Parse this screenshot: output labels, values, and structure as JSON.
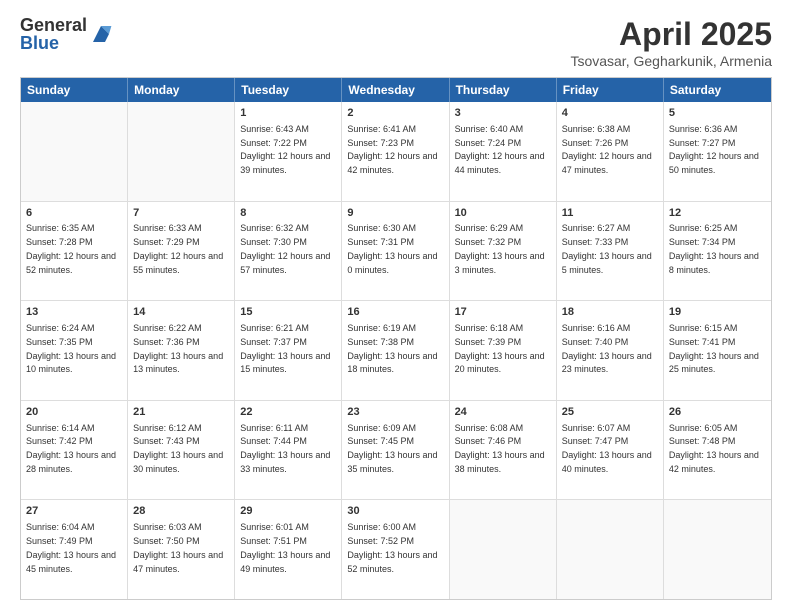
{
  "logo": {
    "general": "General",
    "blue": "Blue"
  },
  "title": "April 2025",
  "location": "Tsovasar, Gegharkunik, Armenia",
  "days": [
    "Sunday",
    "Monday",
    "Tuesday",
    "Wednesday",
    "Thursday",
    "Friday",
    "Saturday"
  ],
  "weeks": [
    [
      {
        "day": "",
        "text": ""
      },
      {
        "day": "",
        "text": ""
      },
      {
        "day": "1",
        "text": "Sunrise: 6:43 AM\nSunset: 7:22 PM\nDaylight: 12 hours and 39 minutes."
      },
      {
        "day": "2",
        "text": "Sunrise: 6:41 AM\nSunset: 7:23 PM\nDaylight: 12 hours and 42 minutes."
      },
      {
        "day": "3",
        "text": "Sunrise: 6:40 AM\nSunset: 7:24 PM\nDaylight: 12 hours and 44 minutes."
      },
      {
        "day": "4",
        "text": "Sunrise: 6:38 AM\nSunset: 7:26 PM\nDaylight: 12 hours and 47 minutes."
      },
      {
        "day": "5",
        "text": "Sunrise: 6:36 AM\nSunset: 7:27 PM\nDaylight: 12 hours and 50 minutes."
      }
    ],
    [
      {
        "day": "6",
        "text": "Sunrise: 6:35 AM\nSunset: 7:28 PM\nDaylight: 12 hours and 52 minutes."
      },
      {
        "day": "7",
        "text": "Sunrise: 6:33 AM\nSunset: 7:29 PM\nDaylight: 12 hours and 55 minutes."
      },
      {
        "day": "8",
        "text": "Sunrise: 6:32 AM\nSunset: 7:30 PM\nDaylight: 12 hours and 57 minutes."
      },
      {
        "day": "9",
        "text": "Sunrise: 6:30 AM\nSunset: 7:31 PM\nDaylight: 13 hours and 0 minutes."
      },
      {
        "day": "10",
        "text": "Sunrise: 6:29 AM\nSunset: 7:32 PM\nDaylight: 13 hours and 3 minutes."
      },
      {
        "day": "11",
        "text": "Sunrise: 6:27 AM\nSunset: 7:33 PM\nDaylight: 13 hours and 5 minutes."
      },
      {
        "day": "12",
        "text": "Sunrise: 6:25 AM\nSunset: 7:34 PM\nDaylight: 13 hours and 8 minutes."
      }
    ],
    [
      {
        "day": "13",
        "text": "Sunrise: 6:24 AM\nSunset: 7:35 PM\nDaylight: 13 hours and 10 minutes."
      },
      {
        "day": "14",
        "text": "Sunrise: 6:22 AM\nSunset: 7:36 PM\nDaylight: 13 hours and 13 minutes."
      },
      {
        "day": "15",
        "text": "Sunrise: 6:21 AM\nSunset: 7:37 PM\nDaylight: 13 hours and 15 minutes."
      },
      {
        "day": "16",
        "text": "Sunrise: 6:19 AM\nSunset: 7:38 PM\nDaylight: 13 hours and 18 minutes."
      },
      {
        "day": "17",
        "text": "Sunrise: 6:18 AM\nSunset: 7:39 PM\nDaylight: 13 hours and 20 minutes."
      },
      {
        "day": "18",
        "text": "Sunrise: 6:16 AM\nSunset: 7:40 PM\nDaylight: 13 hours and 23 minutes."
      },
      {
        "day": "19",
        "text": "Sunrise: 6:15 AM\nSunset: 7:41 PM\nDaylight: 13 hours and 25 minutes."
      }
    ],
    [
      {
        "day": "20",
        "text": "Sunrise: 6:14 AM\nSunset: 7:42 PM\nDaylight: 13 hours and 28 minutes."
      },
      {
        "day": "21",
        "text": "Sunrise: 6:12 AM\nSunset: 7:43 PM\nDaylight: 13 hours and 30 minutes."
      },
      {
        "day": "22",
        "text": "Sunrise: 6:11 AM\nSunset: 7:44 PM\nDaylight: 13 hours and 33 minutes."
      },
      {
        "day": "23",
        "text": "Sunrise: 6:09 AM\nSunset: 7:45 PM\nDaylight: 13 hours and 35 minutes."
      },
      {
        "day": "24",
        "text": "Sunrise: 6:08 AM\nSunset: 7:46 PM\nDaylight: 13 hours and 38 minutes."
      },
      {
        "day": "25",
        "text": "Sunrise: 6:07 AM\nSunset: 7:47 PM\nDaylight: 13 hours and 40 minutes."
      },
      {
        "day": "26",
        "text": "Sunrise: 6:05 AM\nSunset: 7:48 PM\nDaylight: 13 hours and 42 minutes."
      }
    ],
    [
      {
        "day": "27",
        "text": "Sunrise: 6:04 AM\nSunset: 7:49 PM\nDaylight: 13 hours and 45 minutes."
      },
      {
        "day": "28",
        "text": "Sunrise: 6:03 AM\nSunset: 7:50 PM\nDaylight: 13 hours and 47 minutes."
      },
      {
        "day": "29",
        "text": "Sunrise: 6:01 AM\nSunset: 7:51 PM\nDaylight: 13 hours and 49 minutes."
      },
      {
        "day": "30",
        "text": "Sunrise: 6:00 AM\nSunset: 7:52 PM\nDaylight: 13 hours and 52 minutes."
      },
      {
        "day": "",
        "text": ""
      },
      {
        "day": "",
        "text": ""
      },
      {
        "day": "",
        "text": ""
      }
    ]
  ]
}
